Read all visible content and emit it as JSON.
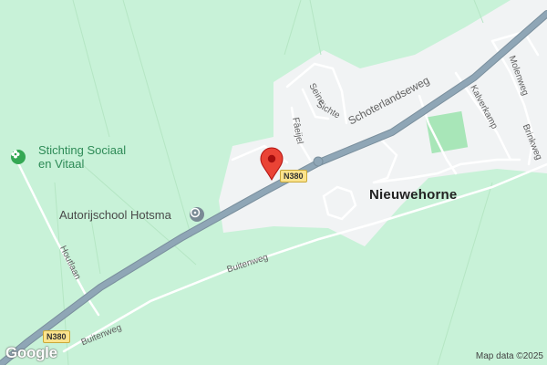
{
  "map": {
    "roads": {
      "main": "Schoterlandseweg",
      "buitenweg_1": "Buitenweg",
      "buitenweg_2": "Buitenweg",
      "houtlaan": "Houtlaan",
      "seine": "Seine",
      "sichte": "Sichte",
      "faeijel": "Fâeijel",
      "kalverkamp": "Kalverkamp",
      "molenweg": "Molenweg",
      "brinkweg": "Brinkweg"
    },
    "route_shields": [
      "N380",
      "N380"
    ],
    "place": "Nieuwehorne",
    "pois": [
      {
        "line1": "Stichting Sociaal",
        "line2": "en Vitaal",
        "icon": "flower-icon"
      },
      {
        "line1": "Autorijschool Hotsma",
        "icon": "steering-wheel-icon"
      }
    ],
    "pin_icon": "location-pin-icon",
    "logo": "Google",
    "attribution": "Map data ©2025",
    "colors": {
      "land": "#c8f2d8",
      "urban": "#f1f3f4",
      "highway": "#8fa6b6",
      "road": "#ffffff",
      "pin": "#ea4335",
      "park": "#a8e6b8"
    }
  }
}
